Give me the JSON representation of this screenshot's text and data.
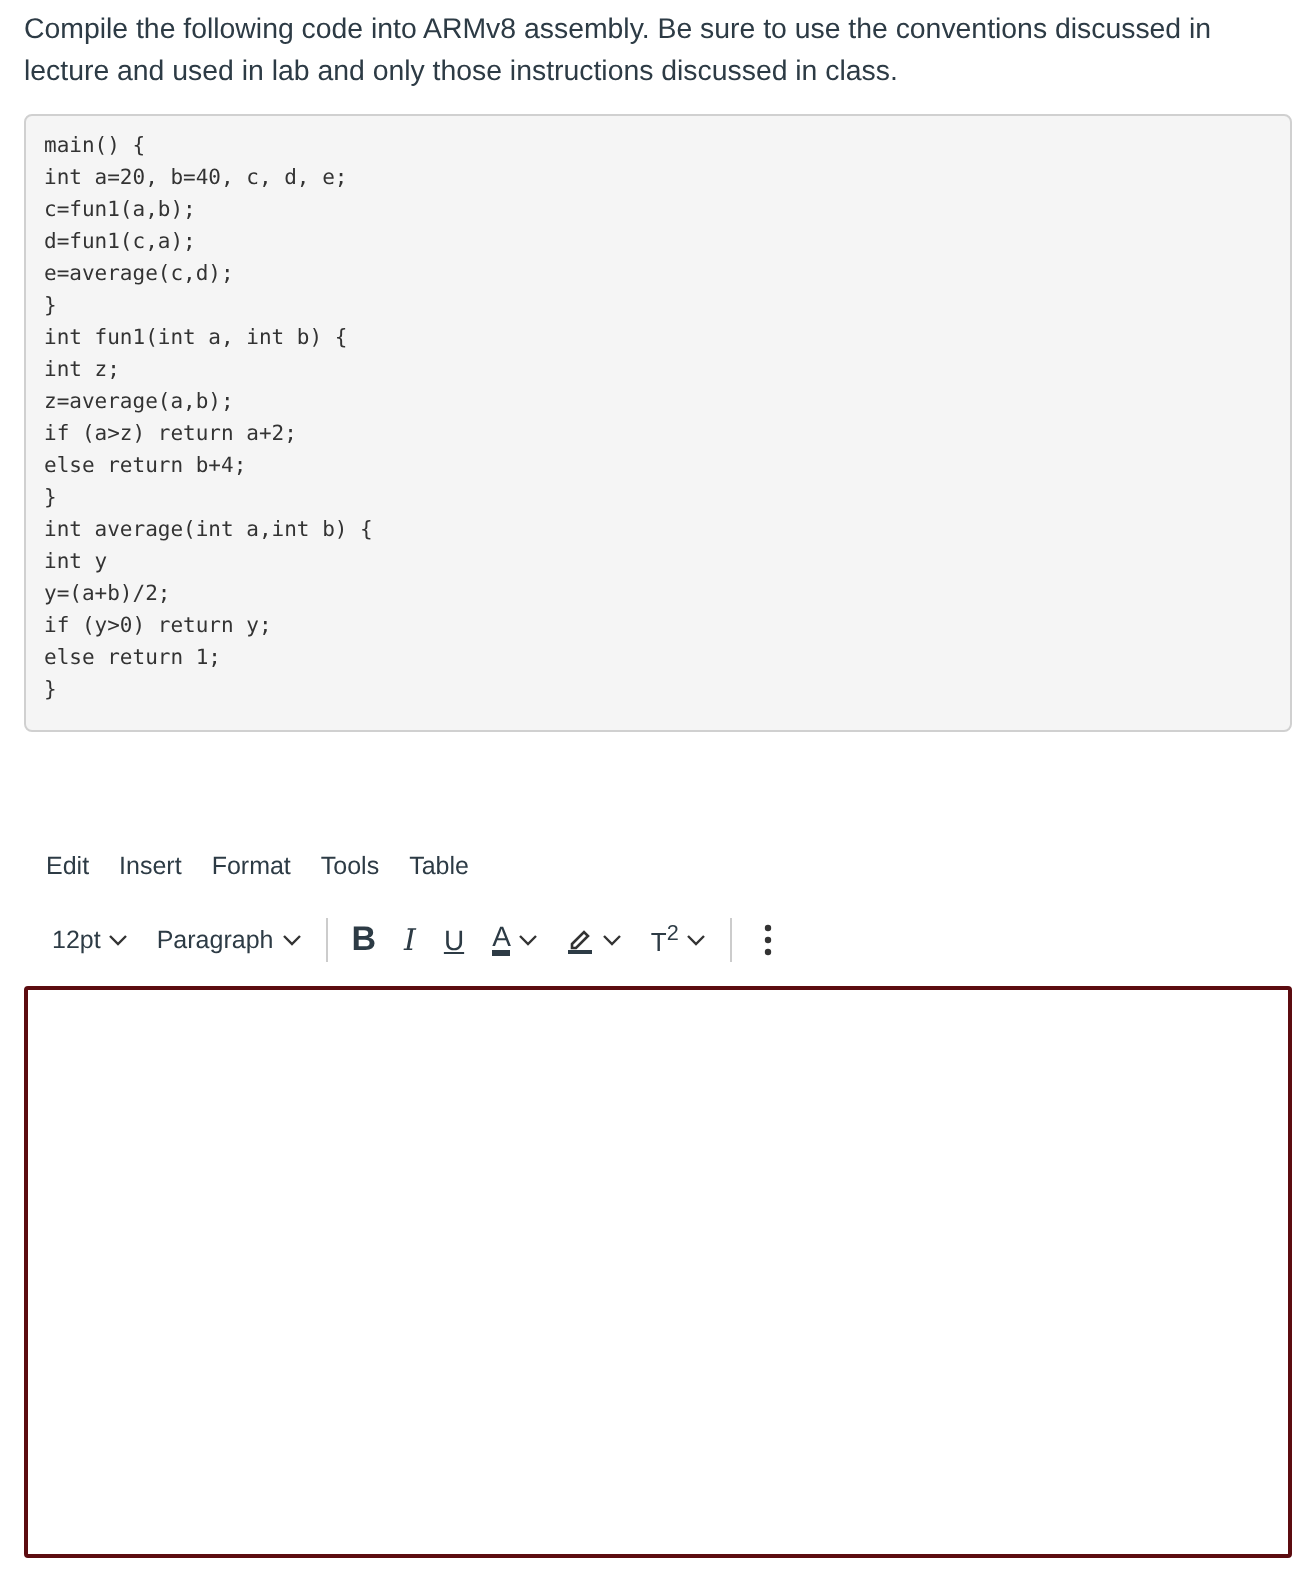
{
  "question": {
    "text": "Compile the following code into ARMv8 assembly. Be sure to use the conventions discussed in lecture and used in lab and only those instructions discussed in class."
  },
  "code_block": {
    "lines": [
      "main() {",
      "int a=20, b=40, c, d, e;",
      "c=fun1(a,b);",
      "d=fun1(c,a);",
      "e=average(c,d);",
      "}",
      "int fun1(int a, int b) {",
      "int z;",
      "z=average(a,b);",
      "if (a>z) return a+2;",
      "else return b+4;",
      "}",
      "int average(int a,int b) {",
      "int y",
      "y=(a+b)/2;",
      "if (y>0) return y;",
      "else return 1;",
      "}"
    ]
  },
  "editor": {
    "menu": [
      "Edit",
      "Insert",
      "Format",
      "Tools",
      "Table"
    ],
    "toolbar": [
      {
        "kind": "dropdown",
        "label": "12pt"
      },
      {
        "kind": "dropdown",
        "label": "Paragraph"
      },
      {
        "kind": "divider"
      },
      {
        "kind": "bold",
        "label": "B"
      },
      {
        "kind": "italic",
        "label": "I"
      },
      {
        "kind": "underline",
        "label": "U"
      },
      {
        "kind": "text-color",
        "label": "A"
      },
      {
        "kind": "highlight"
      },
      {
        "kind": "superscript",
        "label": "T$^{2}$"
      },
      {
        "kind": "divider"
      },
      {
        "kind": "more"
      }
    ]
  }
}
